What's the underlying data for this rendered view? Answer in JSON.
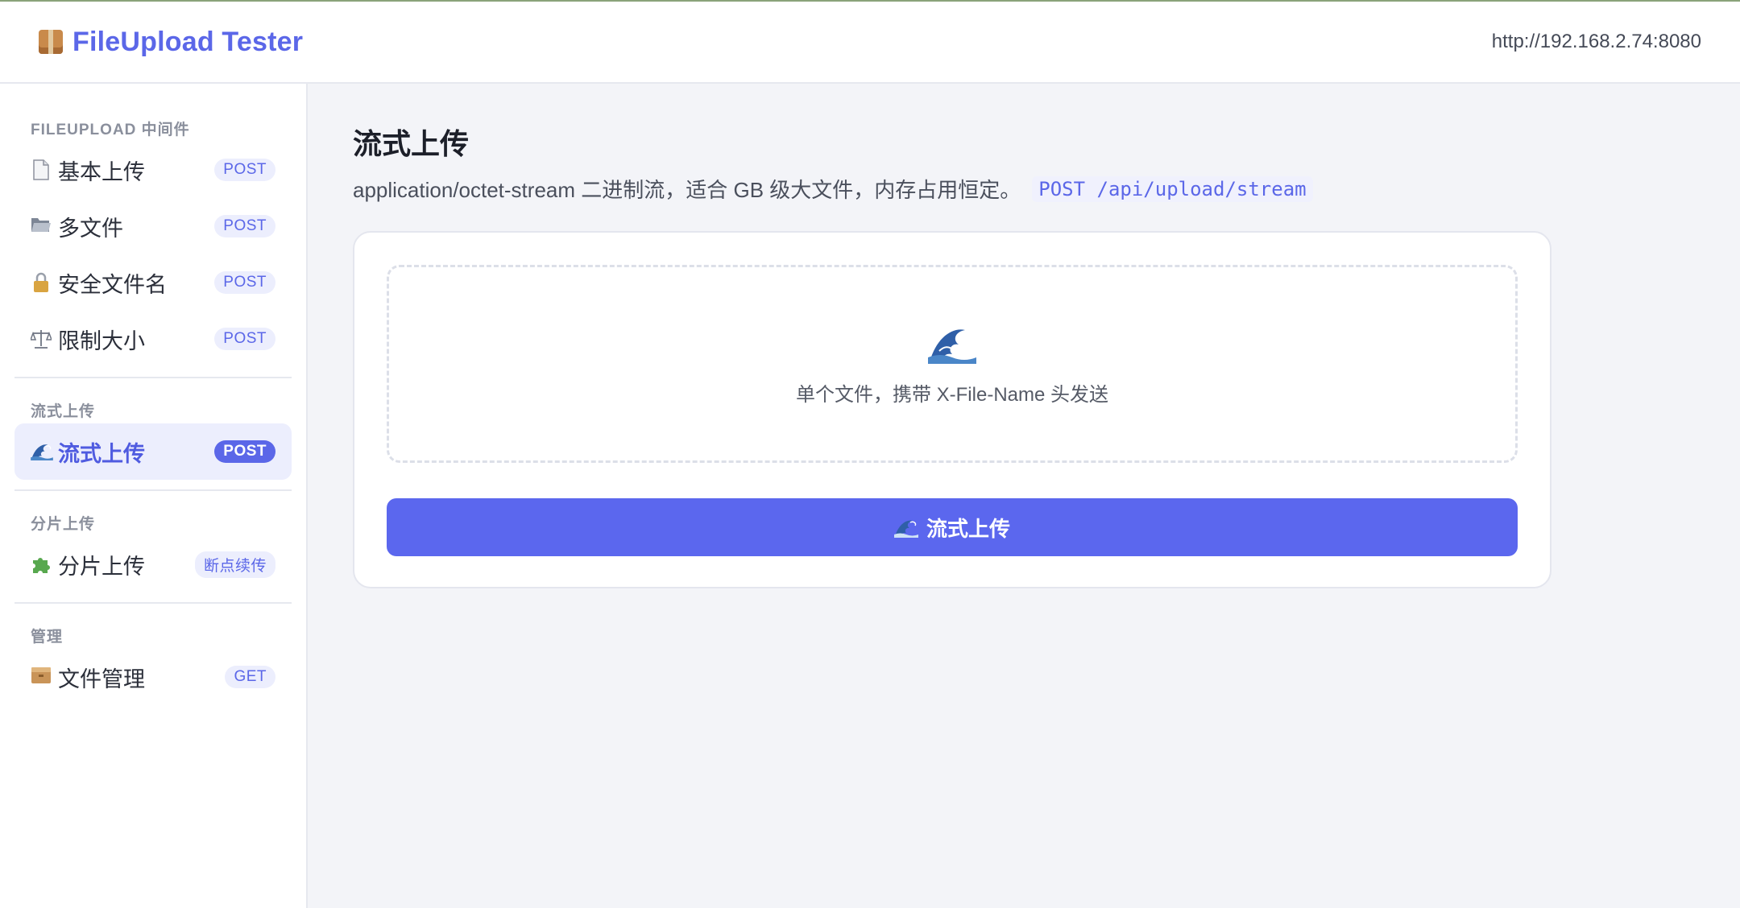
{
  "header": {
    "brand_icon": "package-icon",
    "title": "FileUpload Tester",
    "server_url": "http://192.168.2.74:8080"
  },
  "sidebar": {
    "sections": [
      {
        "title": "FILEUPLOAD 中间件",
        "items": [
          {
            "icon": "page-icon",
            "label": "基本上传",
            "badge": "POST"
          },
          {
            "icon": "folder-icon",
            "label": "多文件",
            "badge": "POST"
          },
          {
            "icon": "lock-icon",
            "label": "安全文件名",
            "badge": "POST"
          },
          {
            "icon": "scales-icon",
            "label": "限制大小",
            "badge": "POST"
          }
        ]
      },
      {
        "title": "流式上传",
        "items": [
          {
            "icon": "wave-icon",
            "label": "流式上传",
            "badge": "POST",
            "active": true
          }
        ]
      },
      {
        "title": "分片上传",
        "items": [
          {
            "icon": "puzzle-icon",
            "label": "分片上传",
            "badge": "断点续传"
          }
        ]
      },
      {
        "title": "管理",
        "items": [
          {
            "icon": "file-cabinet-icon",
            "label": "文件管理",
            "badge": "GET"
          }
        ]
      }
    ]
  },
  "main": {
    "title": "流式上传",
    "description": "application/octet-stream 二进制流，适合 GB 级大文件，内存占用恒定。",
    "endpoint": "POST /api/upload/stream",
    "dropzone": {
      "icon": "wave-icon",
      "hint": "单个文件，携带 X-File-Name 头发送"
    },
    "upload_button": {
      "icon": "wave-icon",
      "label": "流式上传"
    }
  },
  "colors": {
    "accent": "#5b67ee",
    "badge_bg": "#eceefd",
    "page_bg": "#f3f4f8"
  }
}
